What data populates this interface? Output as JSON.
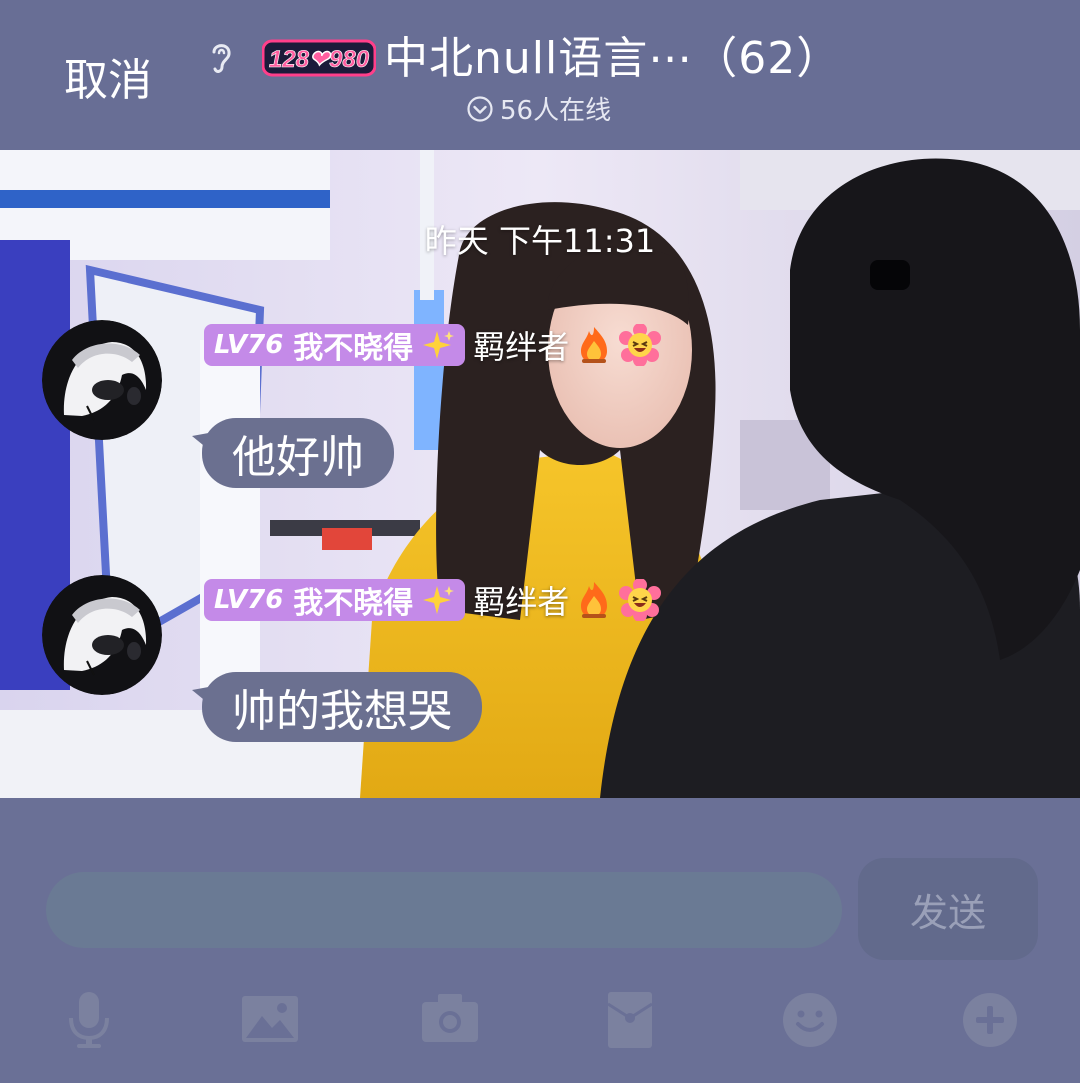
{
  "header": {
    "cancel_label": "取消",
    "logo_text": "128❤980",
    "group_title": "中北null语言⋯（62）",
    "online_text": "56人在线"
  },
  "chat": {
    "timestamp": "昨天 下午11:31",
    "messages": [
      {
        "level": "LV76",
        "nickname": "我不晓得",
        "title": "羁绊者",
        "text": "他好帅"
      },
      {
        "level": "LV76",
        "nickname": "我不晓得",
        "title": "羁绊者",
        "text": "帅的我想哭"
      }
    ]
  },
  "input": {
    "value": "",
    "placeholder": "",
    "send_label": "发送"
  },
  "toolbar": {
    "items": [
      "microphone-icon",
      "image-icon",
      "camera-icon",
      "red-packet-icon",
      "emoji-icon",
      "plus-icon"
    ]
  },
  "colors": {
    "header_bg": "#686e95",
    "badge": "#c48ae8",
    "bubble": "#6b7090",
    "input_bg": "#6a7a94",
    "send_button": "#626a8c"
  }
}
